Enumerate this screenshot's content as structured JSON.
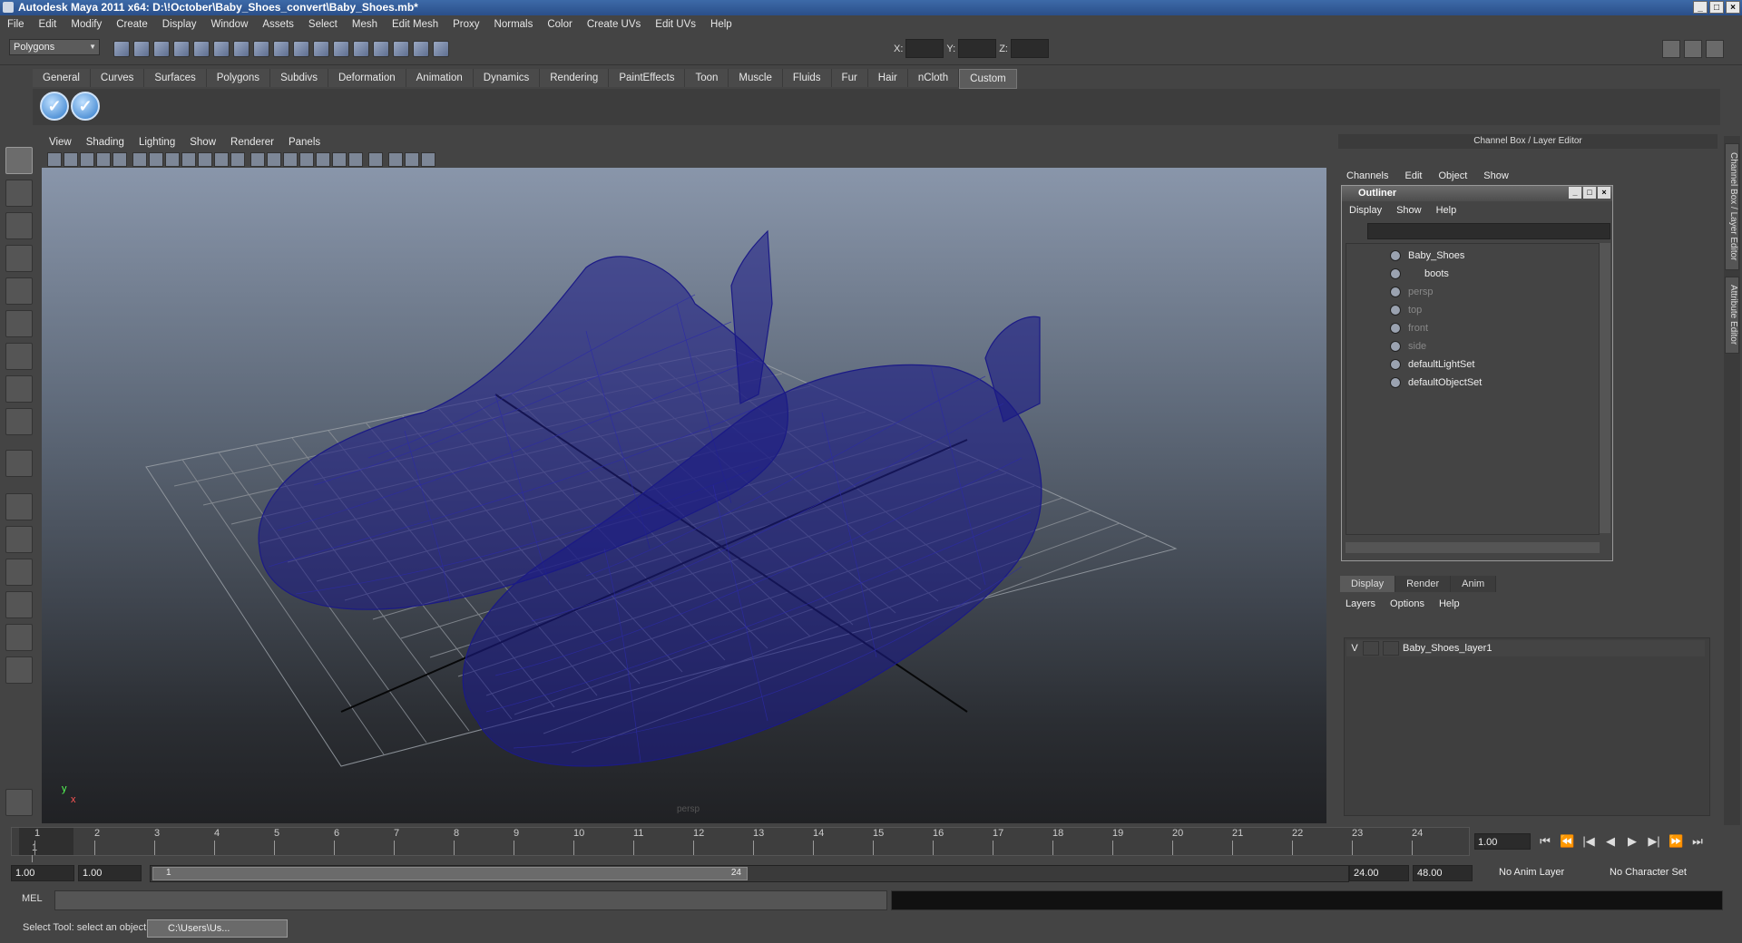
{
  "window": {
    "title": "Autodesk Maya 2011 x64: D:\\!October\\Baby_Shoes_convert\\Baby_Shoes.mb*",
    "buttons": [
      "_",
      "□",
      "×"
    ]
  },
  "menubar": [
    "File",
    "Edit",
    "Modify",
    "Create",
    "Display",
    "Window",
    "Assets",
    "Select",
    "Mesh",
    "Edit Mesh",
    "Proxy",
    "Normals",
    "Color",
    "Create UVs",
    "Edit UVs",
    "Help"
  ],
  "toolbar": {
    "mode": "Polygons",
    "x_label": "X:",
    "y_label": "Y:",
    "z_label": "Z:"
  },
  "shelf": {
    "tabs": [
      "General",
      "Curves",
      "Surfaces",
      "Polygons",
      "Subdivs",
      "Deformation",
      "Animation",
      "Dynamics",
      "Rendering",
      "PaintEffects",
      "Toon",
      "Muscle",
      "Fluids",
      "Fur",
      "Hair",
      "nCloth",
      "Custom"
    ],
    "active_tab": "Custom",
    "buttons": [
      "check-icon",
      "check-icon"
    ]
  },
  "viewport": {
    "menu": [
      "View",
      "Shading",
      "Lighting",
      "Show",
      "Renderer",
      "Panels"
    ],
    "axis_x": "x",
    "axis_y": "y",
    "camera_label": "persp",
    "wire_color": "#1b1a86"
  },
  "channel_box": {
    "title": "Channel Box / Layer Editor",
    "menu": [
      "Channels",
      "Edit",
      "Object",
      "Show"
    ]
  },
  "side_tabs": [
    "Channel Box / Layer Editor",
    "Attribute Editor"
  ],
  "outliner": {
    "title": "Outliner",
    "menu": [
      "Display",
      "Show",
      "Help"
    ],
    "items": [
      {
        "label": "Baby_Shoes",
        "dim": false
      },
      {
        "label": "boots",
        "dim": false
      },
      {
        "label": "persp",
        "dim": true
      },
      {
        "label": "top",
        "dim": true
      },
      {
        "label": "front",
        "dim": true
      },
      {
        "label": "side",
        "dim": true
      },
      {
        "label": "defaultLightSet",
        "dim": false
      },
      {
        "label": "defaultObjectSet",
        "dim": false
      }
    ]
  },
  "layers": {
    "tabs": [
      "Display",
      "Render",
      "Anim"
    ],
    "active_tab": "Display",
    "menu": [
      "Layers",
      "Options",
      "Help"
    ],
    "rows": [
      {
        "visible": "V",
        "name": "Baby_Shoes_layer1"
      }
    ]
  },
  "timeline": {
    "ticks": [
      "1",
      "2",
      "3",
      "4",
      "5",
      "6",
      "7",
      "8",
      "9",
      "10",
      "11",
      "12",
      "13",
      "14",
      "15",
      "16",
      "17",
      "18",
      "19",
      "20",
      "21",
      "22",
      "23",
      "24"
    ],
    "current_frame_label": "1",
    "current_frame": "1.00"
  },
  "range": {
    "start": "1.00",
    "playback_start": "1.00",
    "knob_start": "1",
    "knob_end": "24",
    "playback_end": "24.00",
    "end": "48.00",
    "anim_layer": "No Anim Layer",
    "character_set": "No Character Set"
  },
  "command_line": {
    "label": "MEL"
  },
  "help_line": {
    "text": "Select Tool: select an object",
    "task": "C:\\Users\\Us..."
  }
}
